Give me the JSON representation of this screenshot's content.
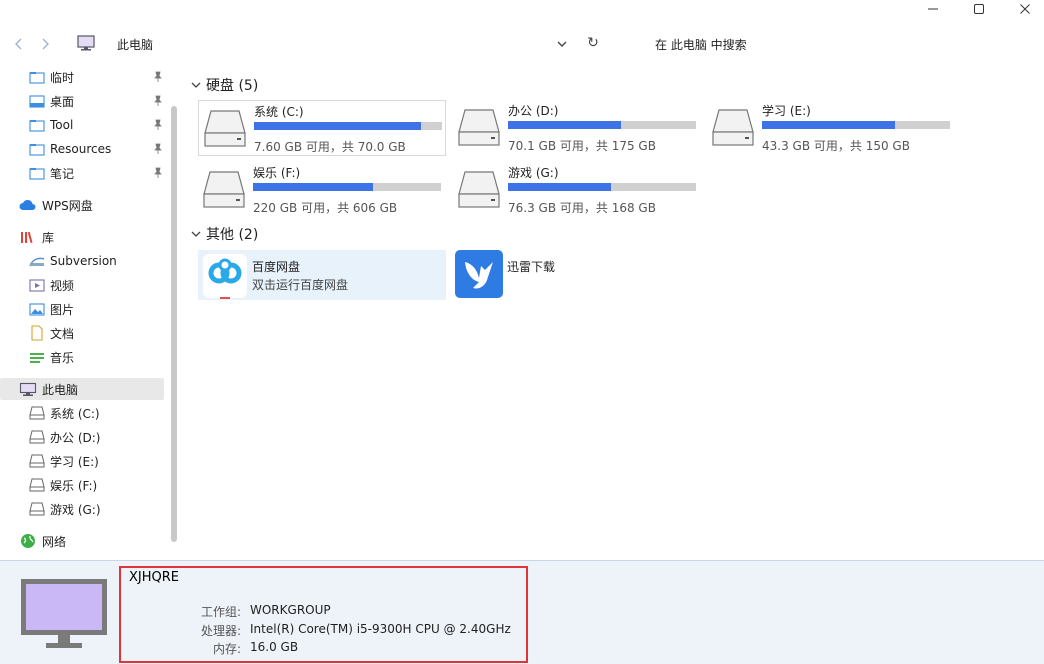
{
  "window": {
    "minimize_label": "minimize",
    "maximize_label": "maximize",
    "close_label": "close"
  },
  "address": {
    "location": "此电脑",
    "search_placeholder": "在 此电脑 中搜索"
  },
  "sidebar": {
    "quick_access": [
      {
        "label": "临时",
        "icon": "folder-icon",
        "pinned": true
      },
      {
        "label": "桌面",
        "icon": "desktop-icon",
        "pinned": true
      },
      {
        "label": "Tool",
        "icon": "folder-icon",
        "pinned": true
      },
      {
        "label": "Resources",
        "icon": "folder-icon",
        "pinned": true
      },
      {
        "label": "笔记",
        "icon": "folder-icon",
        "pinned": true
      }
    ],
    "wps": "WPS网盘",
    "library": "库",
    "library_items": [
      "Subversion",
      "视频",
      "图片",
      "文档",
      "音乐"
    ],
    "this_pc": "此电脑",
    "drives": [
      "系统 (C:)",
      "办公 (D:)",
      "学习 (E:)",
      "娱乐 (F:)",
      "游戏 (G:)"
    ],
    "network": "网络"
  },
  "main": {
    "hard_disks_title": "硬盘 (5)",
    "others_title": "其他 (2)",
    "drives": [
      {
        "name": "系统 (C:)",
        "info": "7.60 GB 可用，共 70.0 GB",
        "used_fraction": 0.89
      },
      {
        "name": "办公 (D:)",
        "info": "70.1 GB 可用，共 175 GB",
        "used_fraction": 0.6
      },
      {
        "name": "学习 (E:)",
        "info": "43.3 GB 可用，共 150 GB",
        "used_fraction": 0.71
      },
      {
        "name": "娱乐 (F:)",
        "info": "220 GB 可用，共 606 GB",
        "used_fraction": 0.64
      },
      {
        "name": "游戏 (G:)",
        "info": "76.3 GB 可用，共 168 GB",
        "used_fraction": 0.55
      }
    ],
    "apps": [
      {
        "name": "百度网盘",
        "desc": "双击运行百度网盘"
      },
      {
        "name": "迅雷下载",
        "desc": ""
      }
    ]
  },
  "details": {
    "pc_name": "XJHQRE",
    "workgroup_label": "工作组:",
    "workgroup": "WORKGROUP",
    "processor_label": "处理器:",
    "processor": "Intel(R) Core(TM) i5-9300H CPU @ 2.40GHz",
    "memory_label": "内存:",
    "memory": "16.0 GB"
  },
  "colors": {
    "accent": "#3d73e6",
    "selection_border": "#e0333a",
    "details_bg": "#eef3f9"
  }
}
